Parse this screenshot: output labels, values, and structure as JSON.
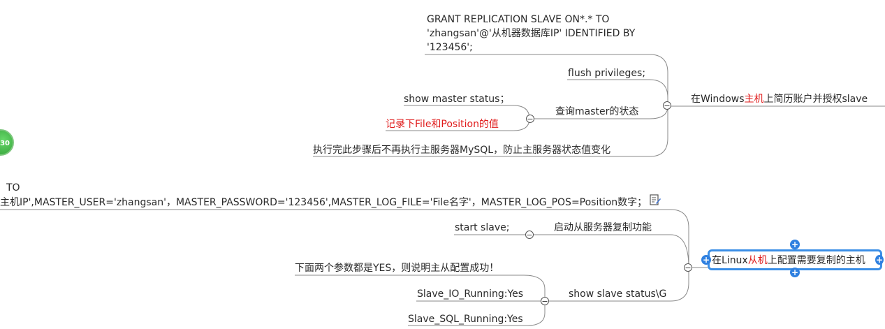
{
  "badge": {
    "count": "30"
  },
  "windows_branch": {
    "root_pre": "在Windows",
    "root_red": "主机",
    "root_post": "上简历账户并授权slave",
    "grant_line1": "GRANT REPLICATION SLAVE  ON*.* TO",
    "grant_line2": "'zhangsan'@'从机器数据库IP' IDENTIFIED BY",
    "grant_line3": "'123456';",
    "flush": "flush privileges;",
    "query_status": "查询master的状态",
    "show_master": "show master status；",
    "record_note": "记录下File和Position的值",
    "after_note": "执行完此步骤后不再执行主服务器MySQL，防止主服务器状态值变化"
  },
  "linux_branch": {
    "root_pre": "在Linux",
    "root_red": "从机",
    "root_post": "上配置需要复制的主机",
    "to_fragment": "TO",
    "change_master": "主机IP',MASTER_USER='zhangsan'，MASTER_PASSWORD='123456',MASTER_LOG_FILE='File名字'，MASTER_LOG_POS=Position数字；",
    "start_slave_label": "启动从服务器复制功能",
    "start_slave_cmd": "start slave;",
    "show_slave": "show slave status\\G",
    "success_note": "下面两个参数都是YES，则说明主从配置成功！",
    "io_running": "Slave_IO_Running:Yes",
    "sql_running": "Slave_SQL_Running:Yes"
  },
  "icons": {
    "collapse": "collapse-minus-icon",
    "edit": "note-edit-icon",
    "add": "add-node-icon"
  },
  "colors": {
    "accent_red": "#e01b1b",
    "selection_blue": "#3a8ee6",
    "badge_green": "#2e9c33",
    "line_gray": "#8a8a8a"
  }
}
